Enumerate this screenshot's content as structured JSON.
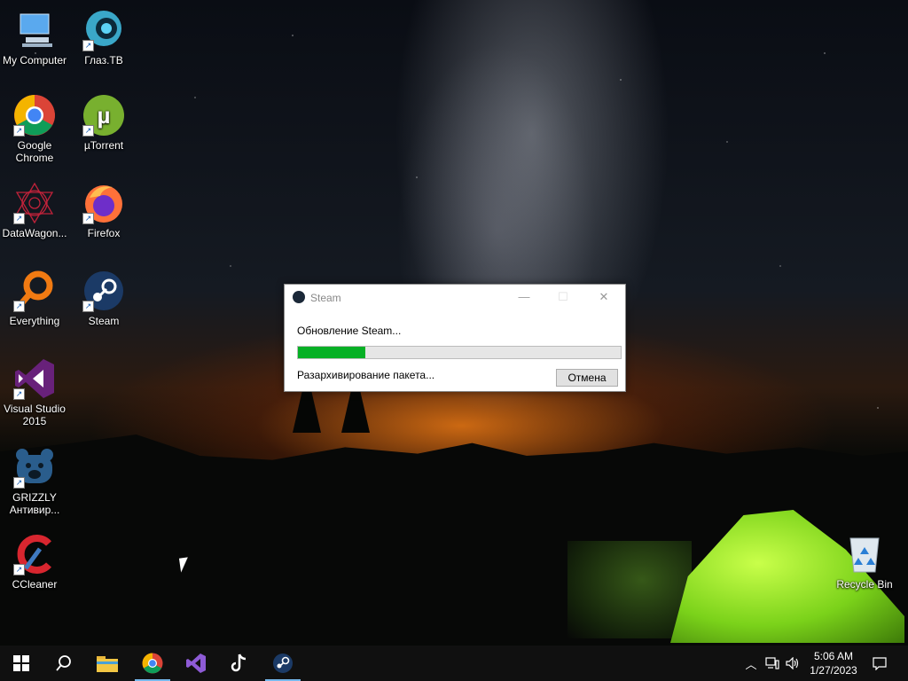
{
  "desktop": {
    "icons": [
      {
        "label": "My Computer"
      },
      {
        "label": "Глаз.ТВ"
      },
      {
        "label": "Google Chrome"
      },
      {
        "label": "µTorrent"
      },
      {
        "label": "DataWagon..."
      },
      {
        "label": "Firefox"
      },
      {
        "label": "Everything"
      },
      {
        "label": "Steam"
      },
      {
        "label": "Visual Studio 2015"
      },
      {
        "label": "GRIZZLY Антивир..."
      },
      {
        "label": "CCleaner"
      },
      {
        "label": "Recycle Bin"
      }
    ]
  },
  "dialog": {
    "title": "Steam",
    "message": "Обновление Steam...",
    "progress_fraction": 0.21,
    "status": "Разархивирование пакета...",
    "cancel_label": "Отмена",
    "minimize_glyph": "—",
    "maximize_glyph": "☐",
    "close_glyph": "✕"
  },
  "taskbar": {
    "clock": {
      "time": "5:06 AM",
      "date": "1/27/2023"
    },
    "colors": {
      "accent": "#76b9ed",
      "progress": "#06b025"
    }
  }
}
